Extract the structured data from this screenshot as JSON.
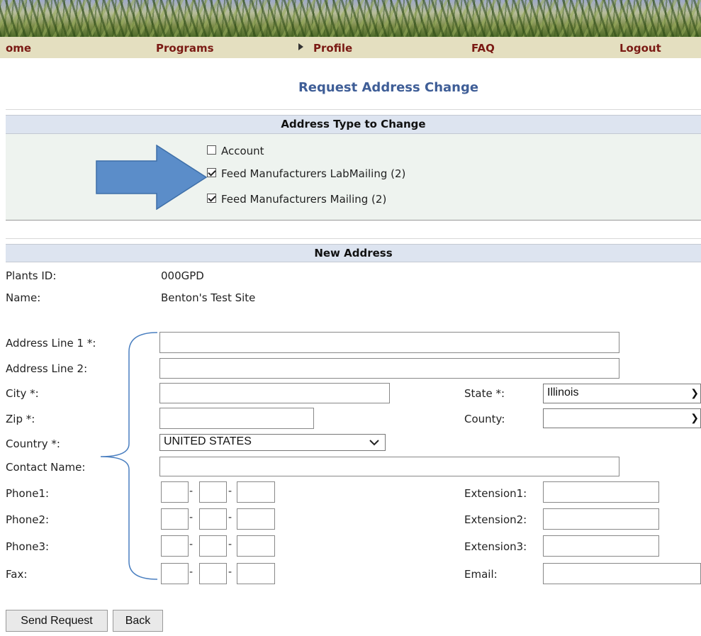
{
  "nav": {
    "home": "ome",
    "programs": "Programs",
    "profile": "Profile",
    "faq": "FAQ",
    "logout": "Logout"
  },
  "page_title": "Request Address Change",
  "address_type": {
    "header": "Address Type to Change",
    "options": [
      {
        "label": "Account",
        "checked": false
      },
      {
        "label": "Feed Manufacturers LabMailing (2)",
        "checked": true
      },
      {
        "label": "Feed Manufacturers Mailing (2)",
        "checked": true
      }
    ]
  },
  "new_address": {
    "header": "New Address",
    "plants_id_label": "Plants ID:",
    "plants_id_value": "000GPD",
    "name_label": "Name:",
    "name_value": "Benton's Test Site",
    "address1_label": "Address Line 1 *:",
    "address2_label": "Address Line 2:",
    "city_label": "City *:",
    "state_label": "State *:",
    "state_value": "Illinois",
    "zip_label": "Zip *:",
    "county_label": "County:",
    "county_value": "",
    "country_label": "Country *:",
    "country_value": "UNITED STATES",
    "contact_label": "Contact Name:",
    "phone1_label": "Phone1:",
    "phone2_label": "Phone2:",
    "phone3_label": "Phone3:",
    "fax_label": "Fax:",
    "ext1_label": "Extension1:",
    "ext2_label": "Extension2:",
    "ext3_label": "Extension3:",
    "email_label": "Email:",
    "dash": "-"
  },
  "buttons": {
    "send": "Send Request",
    "back": "Back"
  },
  "colors": {
    "nav_text": "#7a1a14",
    "title": "#3f5e97",
    "arrow_fill": "#5b8dc9",
    "bracket": "#4a7fc0"
  }
}
